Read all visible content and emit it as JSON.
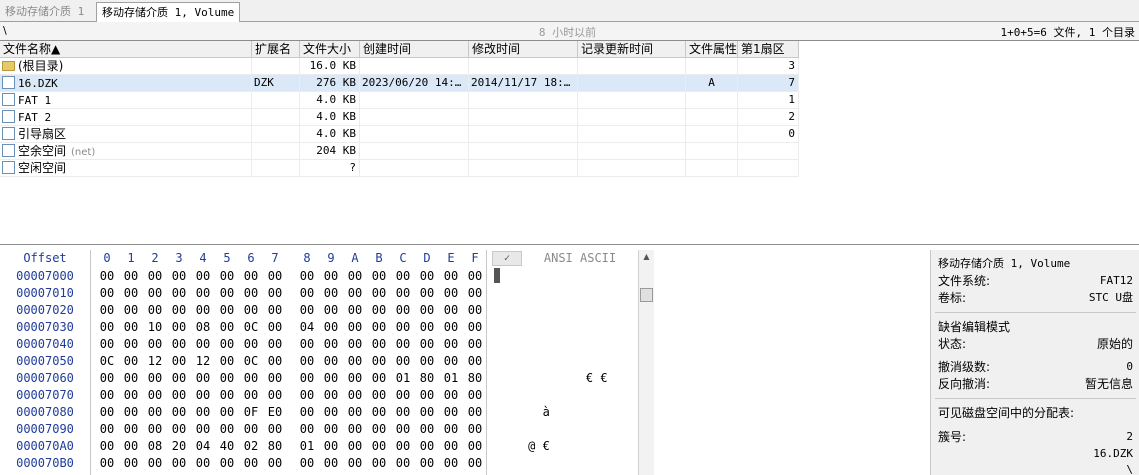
{
  "tabs": [
    {
      "label": "移动存储介质 1",
      "active": false
    },
    {
      "label": "移动存储介质 1, Volume",
      "active": true
    }
  ],
  "pathbar": {
    "path": "\\",
    "time_ago": "8 小时以前",
    "summary": "1+0+5=6 文件, 1 个目录"
  },
  "filelist": {
    "columns": [
      "文件名称▲",
      "扩展名",
      "文件大小",
      "创建时间",
      "修改时间",
      "记录更新时间",
      "文件属性",
      "第1扇区"
    ],
    "rows": [
      {
        "name": "(根目录)",
        "note": "",
        "ext": "",
        "size": "16.0 KB",
        "created": "",
        "modified": "",
        "updated": "",
        "attr": "",
        "sector": "3",
        "icon": "folder-icon",
        "selected": false
      },
      {
        "name": "16.DZK",
        "note": "",
        "ext": "DZK",
        "size": "276 KB",
        "created": "2023/06/20  14:…",
        "modified": "2014/11/17  18:…",
        "updated": "",
        "attr": "A",
        "sector": "7",
        "icon": "file-icon",
        "selected": true
      },
      {
        "name": "FAT 1",
        "note": "",
        "ext": "",
        "size": "4.0 KB",
        "created": "",
        "modified": "",
        "updated": "",
        "attr": "",
        "sector": "1",
        "icon": "file-icon",
        "selected": false
      },
      {
        "name": "FAT 2",
        "note": "",
        "ext": "",
        "size": "4.0 KB",
        "created": "",
        "modified": "",
        "updated": "",
        "attr": "",
        "sector": "2",
        "icon": "file-icon",
        "selected": false
      },
      {
        "name": "引导扇区",
        "note": "",
        "ext": "",
        "size": "4.0 KB",
        "created": "",
        "modified": "",
        "updated": "",
        "attr": "",
        "sector": "0",
        "icon": "file-icon",
        "selected": false
      },
      {
        "name": "空余空间",
        "note": "(net)",
        "ext": "",
        "size": "204 KB",
        "created": "",
        "modified": "",
        "updated": "",
        "attr": "",
        "sector": "",
        "icon": "file-icon",
        "selected": false
      },
      {
        "name": "空闲空间",
        "note": "",
        "ext": "",
        "size": "?",
        "created": "",
        "modified": "",
        "updated": "",
        "attr": "",
        "sector": "",
        "icon": "file-icon",
        "selected": false
      }
    ]
  },
  "hex": {
    "offset_label": "Offset",
    "column_labels": [
      "0",
      "1",
      "2",
      "3",
      "4",
      "5",
      "6",
      "7",
      "8",
      "9",
      "A",
      "B",
      "C",
      "D",
      "E",
      "F"
    ],
    "check_label": "✓",
    "text_label": "ANSI ASCII",
    "rows": [
      {
        "offset": "00007000",
        "bytes": [
          "00",
          "00",
          "00",
          "00",
          "00",
          "00",
          "00",
          "00",
          "00",
          "00",
          "00",
          "00",
          "00",
          "00",
          "00",
          "00"
        ],
        "text": ""
      },
      {
        "offset": "00007010",
        "bytes": [
          "00",
          "00",
          "00",
          "00",
          "00",
          "00",
          "00",
          "00",
          "00",
          "00",
          "00",
          "00",
          "00",
          "00",
          "00",
          "00"
        ],
        "text": ""
      },
      {
        "offset": "00007020",
        "bytes": [
          "00",
          "00",
          "00",
          "00",
          "00",
          "00",
          "00",
          "00",
          "00",
          "00",
          "00",
          "00",
          "00",
          "00",
          "00",
          "00"
        ],
        "text": ""
      },
      {
        "offset": "00007030",
        "bytes": [
          "00",
          "00",
          "10",
          "00",
          "08",
          "00",
          "0C",
          "00",
          "04",
          "00",
          "00",
          "00",
          "00",
          "00",
          "00",
          "00"
        ],
        "text": ""
      },
      {
        "offset": "00007040",
        "bytes": [
          "00",
          "00",
          "00",
          "00",
          "00",
          "00",
          "00",
          "00",
          "00",
          "00",
          "00",
          "00",
          "00",
          "00",
          "00",
          "00"
        ],
        "text": ""
      },
      {
        "offset": "00007050",
        "bytes": [
          "0C",
          "00",
          "12",
          "00",
          "12",
          "00",
          "0C",
          "00",
          "00",
          "00",
          "00",
          "00",
          "00",
          "00",
          "00",
          "00"
        ],
        "text": ""
      },
      {
        "offset": "00007060",
        "bytes": [
          "00",
          "00",
          "00",
          "00",
          "00",
          "00",
          "00",
          "00",
          "00",
          "00",
          "00",
          "00",
          "01",
          "80",
          "01",
          "80"
        ],
        "text": "             € €"
      },
      {
        "offset": "00007070",
        "bytes": [
          "00",
          "00",
          "00",
          "00",
          "00",
          "00",
          "00",
          "00",
          "00",
          "00",
          "00",
          "00",
          "00",
          "00",
          "00",
          "00"
        ],
        "text": ""
      },
      {
        "offset": "00007080",
        "bytes": [
          "00",
          "00",
          "00",
          "00",
          "00",
          "00",
          "0F",
          "E0",
          "00",
          "00",
          "00",
          "00",
          "00",
          "00",
          "00",
          "00"
        ],
        "text": "       à"
      },
      {
        "offset": "00007090",
        "bytes": [
          "00",
          "00",
          "00",
          "00",
          "00",
          "00",
          "00",
          "00",
          "00",
          "00",
          "00",
          "00",
          "00",
          "00",
          "00",
          "00"
        ],
        "text": ""
      },
      {
        "offset": "000070A0",
        "bytes": [
          "00",
          "00",
          "08",
          "20",
          "04",
          "40",
          "02",
          "80",
          "01",
          "00",
          "00",
          "00",
          "00",
          "00",
          "00",
          "00"
        ],
        "text": "     @ €"
      },
      {
        "offset": "000070B0",
        "bytes": [
          "00",
          "00",
          "00",
          "00",
          "00",
          "00",
          "00",
          "00",
          "00",
          "00",
          "00",
          "00",
          "00",
          "00",
          "00",
          "00"
        ],
        "text": ""
      }
    ]
  },
  "info": {
    "volume": "移动存储介质 1, Volume",
    "fs_label": "文件系统:",
    "fs_value": "FAT12",
    "vol_label": "卷标:",
    "vol_value": "STC U盘",
    "mode_title": "缺省编辑模式",
    "state_label": "状态:",
    "state_value": "原始的",
    "undo_level_label": "撤消级数:",
    "undo_level_value": "0",
    "redo_label": "反向撤消:",
    "redo_value": "暂无信息",
    "alloc_title": "可见磁盘空间中的分配表:",
    "cluster_label": "簇号:",
    "cluster_value": "2",
    "cluster_file": "16.DZK",
    "cluster_path": "\\"
  }
}
